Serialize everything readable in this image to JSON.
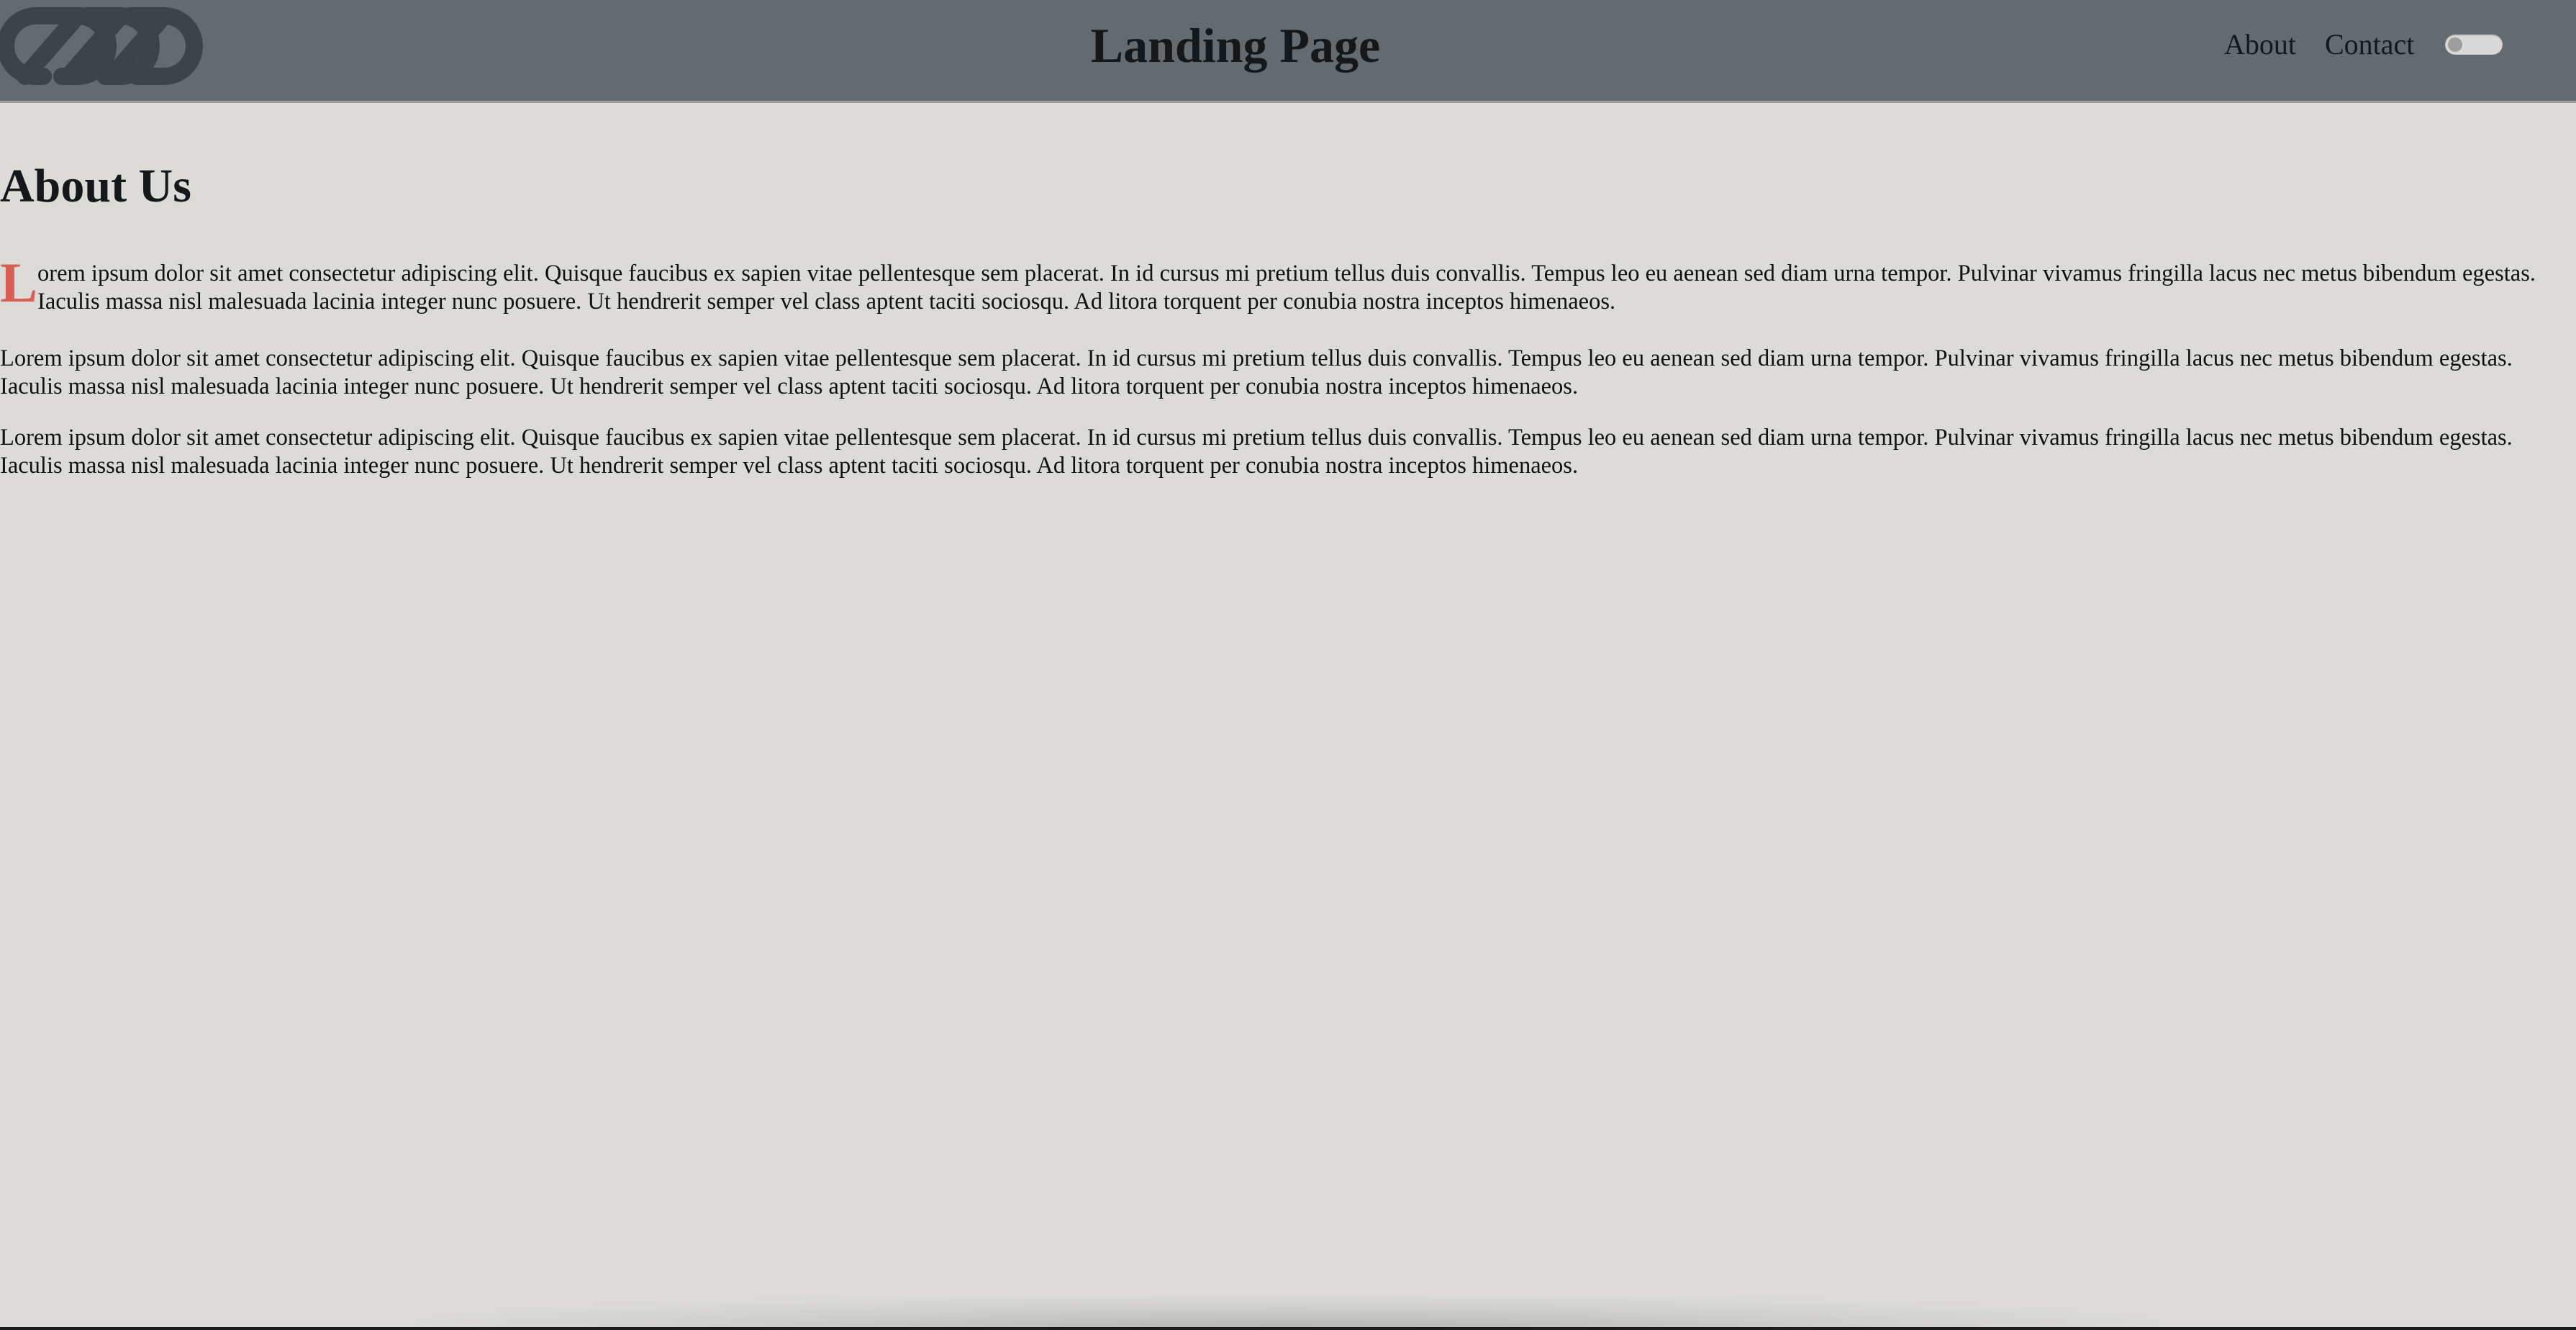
{
  "header": {
    "title": "Landing Page",
    "logo_icon": "chain-link-logo-icon",
    "nav": {
      "about_label": "About",
      "contact_label": "Contact"
    },
    "theme_toggle": {
      "state": "off"
    }
  },
  "main": {
    "heading": "About Us",
    "dropcap": "L",
    "paragraphs": [
      "orem ipsum dolor sit amet consectetur adipiscing elit. Quisque faucibus ex sapien vitae pellentesque sem placerat. In id cursus mi pretium tellus duis convallis. Tempus leo eu aenean sed diam urna tempor. Pulvinar vivamus fringilla lacus nec metus bibendum egestas. Iaculis massa nisl malesuada lacinia integer nunc posuere. Ut hendrerit semper vel class aptent taciti sociosqu. Ad litora torquent per conubia nostra inceptos himenaeos.",
      "Lorem ipsum dolor sit amet consectetur adipiscing elit. Quisque faucibus ex sapien vitae pellentesque sem placerat. In id cursus mi pretium tellus duis convallis. Tempus leo eu aenean sed diam urna tempor. Pulvinar vivamus fringilla lacus nec metus bibendum egestas. Iaculis massa nisl malesuada lacinia integer nunc posuere. Ut hendrerit semper vel class aptent taciti sociosqu. Ad litora torquent per conubia nostra inceptos himenaeos.",
      "Lorem ipsum dolor sit amet consectetur adipiscing elit. Quisque faucibus ex sapien vitae pellentesque sem placerat. In id cursus mi pretium tellus duis convallis. Tempus leo eu aenean sed diam urna tempor. Pulvinar vivamus fringilla lacus nec metus bibendum egestas. Iaculis massa nisl malesuada lacinia integer nunc posuere. Ut hendrerit semper vel class aptent taciti sociosqu. Ad litora torquent per conubia nostra inceptos himenaeos."
    ]
  },
  "colors": {
    "header_bg": "#636b70",
    "page_bg": "#dcdbd7",
    "dropcap": "#d85f55",
    "logo": "#3d4449"
  }
}
